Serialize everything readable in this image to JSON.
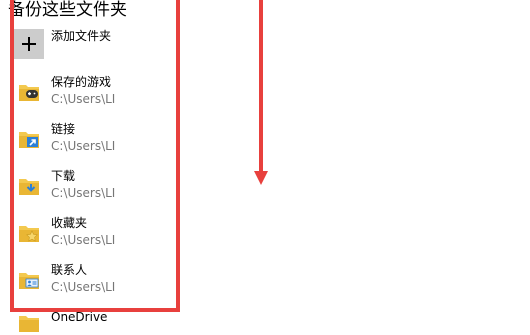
{
  "page": {
    "heading": "备份这些文件夹"
  },
  "add_folder": {
    "label": "添加文件夹",
    "icon": "plus-icon"
  },
  "folders": [
    {
      "name": "保存的游戏",
      "path": "C:\\Users\\LI",
      "icon": "saved-games-folder-icon"
    },
    {
      "name": "链接",
      "path": "C:\\Users\\LI",
      "icon": "links-folder-icon"
    },
    {
      "name": "下载",
      "path": "C:\\Users\\LI",
      "icon": "downloads-folder-icon"
    },
    {
      "name": "收藏夹",
      "path": "C:\\Users\\LI",
      "icon": "favorites-folder-icon"
    },
    {
      "name": "联系人",
      "path": "C:\\Users\\LI",
      "icon": "contacts-folder-icon"
    },
    {
      "name": "OneDrive",
      "icon": "onedrive-folder-icon"
    }
  ],
  "colors": {
    "annotation": "#e8403d",
    "folder": "#f3c94f",
    "accent": "#2b7fd6",
    "path_text": "#767676"
  }
}
